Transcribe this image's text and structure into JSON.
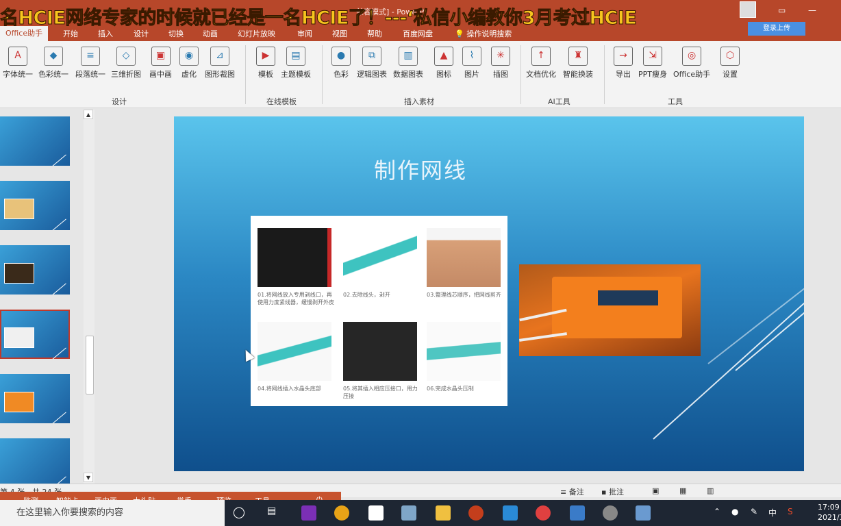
{
  "banner": {
    "text": "名HCIE网络专家的时候就已经是一名HCIE了！---‘私信小编教你3月考过HCIE"
  },
  "window": {
    "title": "兼容模式] - PowerP",
    "login_button": "登录上传"
  },
  "tabs": [
    "Office助手",
    "开始",
    "插入",
    "设计",
    "切换",
    "动画",
    "幻灯片放映",
    "审阅",
    "视图",
    "帮助",
    "百度网盘",
    "操作说明搜索"
  ],
  "ribbon": {
    "buttons": [
      {
        "label": "字体统一",
        "icon": "font-icon"
      },
      {
        "label": "色彩统一",
        "icon": "paint-bucket-icon"
      },
      {
        "label": "段落统一",
        "icon": "paragraph-icon"
      },
      {
        "label": "三维折图",
        "icon": "fold-icon"
      },
      {
        "label": "画中画",
        "icon": "picture-in-picture-icon"
      },
      {
        "label": "虚化",
        "icon": "blur-icon"
      },
      {
        "label": "图形裁图",
        "icon": "crop-icon"
      },
      {
        "label": "模板",
        "icon": "template-icon"
      },
      {
        "label": "主题模板",
        "icon": "theme-icon"
      },
      {
        "label": "色彩",
        "icon": "palette-icon"
      },
      {
        "label": "逻辑图表",
        "icon": "logic-chart-icon"
      },
      {
        "label": "数据图表",
        "icon": "bar-chart-icon"
      },
      {
        "label": "图标",
        "icon": "icon-shapes-icon"
      },
      {
        "label": "图片",
        "icon": "image-icon"
      },
      {
        "label": "插图",
        "icon": "illustration-icon"
      },
      {
        "label": "文档优化",
        "icon": "doc-optimize-icon"
      },
      {
        "label": "智能换装",
        "icon": "smart-change-icon"
      },
      {
        "label": "导出",
        "icon": "export-icon"
      },
      {
        "label": "PPT瘦身",
        "icon": "slim-icon"
      },
      {
        "label": "Office助手",
        "icon": "assistant-icon"
      },
      {
        "label": "设置",
        "icon": "settings-icon"
      }
    ],
    "groups": [
      "设计",
      "在线模板",
      "插入素材",
      "AI工具",
      "工具"
    ]
  },
  "slide": {
    "title": "制作网线",
    "steps": [
      "01.将网线放入专用剥线口，再使用力度紧线器，缓慢剥开外皮",
      "02.去除线头，剥开",
      "03.整理线芯顺序，把网线剪齐",
      "04.将网线插入水晶头底部",
      "05.将其插入相应压接口，用力压接",
      "06.完成水晶头压制"
    ]
  },
  "statusbar": {
    "notes": "备注",
    "comments": "批注",
    "slide_info": "第 4 张，共 24 张"
  },
  "bottom_bar": [
    "监测",
    "智能卡",
    "画中画",
    "大头贴",
    "举手",
    "预览",
    "工具"
  ],
  "taskbar": {
    "search_placeholder": "在这里输入你要搜索的内容",
    "ime": "中",
    "time": "17:09",
    "date": "2021/3/"
  }
}
